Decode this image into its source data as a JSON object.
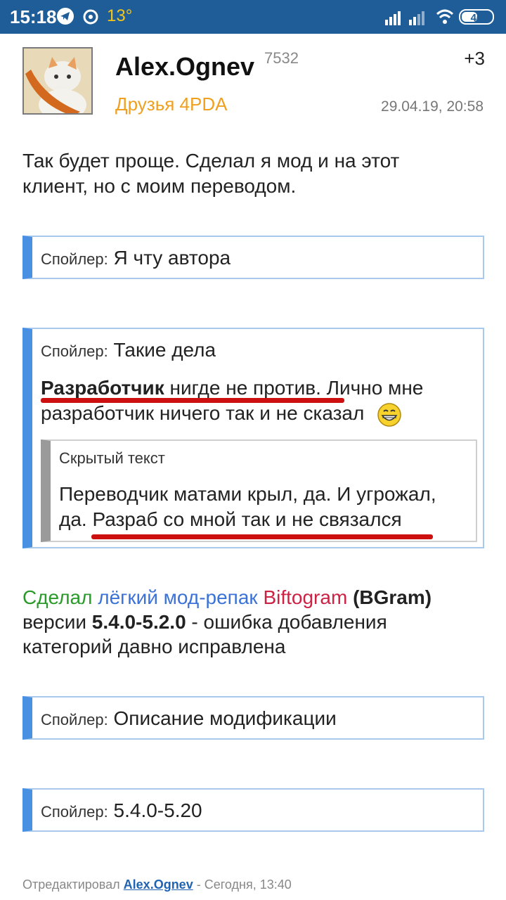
{
  "status_bar": {
    "time": "15:18",
    "temperature": "13°",
    "battery": "46",
    "icons": [
      "telegram-icon",
      "weather-icon",
      "signal-icon",
      "signal-icon",
      "wifi-icon",
      "battery-icon"
    ]
  },
  "post": {
    "author": "Alex.Ognev",
    "reputation": "7532",
    "group": "Друзья 4PDA",
    "karma": "+3",
    "date": "29.04.19, 20:58",
    "intro": [
      "Так будет проще. Сделал я мод и на этот",
      "клиент, но с моим переводом."
    ],
    "spoiler_label": "Спойлер:",
    "spoiler1_title": "Я чту автора",
    "spoiler2": {
      "title": "Такие дела",
      "line1_bold": "Разработчик",
      "line1_rest": " нигде не против. Лично мне",
      "line2": "разработчик ничего так и не сказал",
      "hidden_label": "Скрытый текст",
      "hidden_line1": "Переводчик матами крыл, да. И угрожал,",
      "hidden_line2": "да. Разраб со мной так и не связался"
    },
    "mod": {
      "w1": "Сделал",
      "w2": "лёгкий мод-репак",
      "w3": "Biftogram",
      "w4": "(BGram)",
      "line2_a": "версии ",
      "line2_b": "5.4.0-5.2.0",
      "line2_c": " - ошибка добавления",
      "line3": "категорий давно исправлена"
    },
    "spoiler3_title": "Описание модификации",
    "spoiler4_title": "5.4.0-5.20",
    "edit": {
      "prefix": "Отредактировал",
      "user": "Alex.Ognev",
      "suffix": "- Сегодня, 13:40"
    }
  },
  "colors": {
    "statusbar": "#1f5d98",
    "group": "#f0a020",
    "spoiler_accent": "#4a90e2",
    "underline": "#cc1010"
  }
}
